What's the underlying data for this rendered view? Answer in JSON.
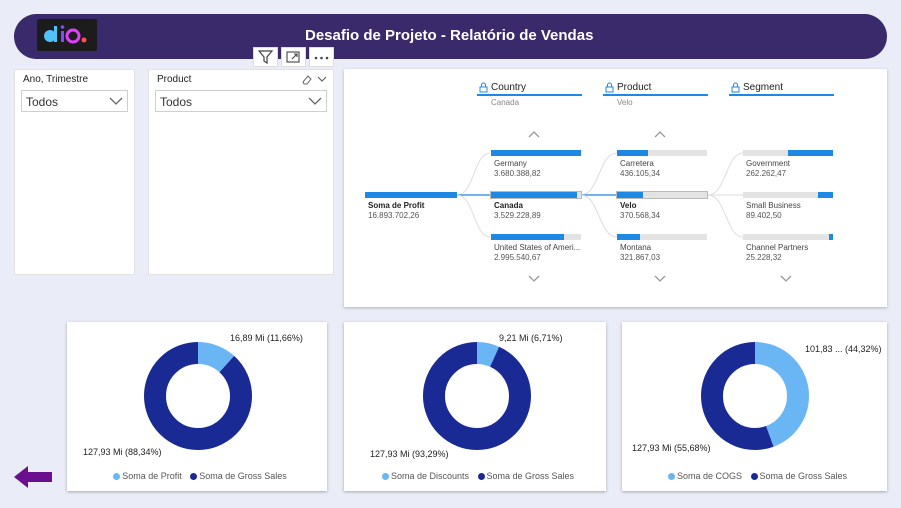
{
  "header": {
    "title": "Desafio de Projeto - Relatório de Vendas",
    "logo_icon": "dio-logo"
  },
  "slicers": [
    {
      "title": "Ano, Trimestre",
      "value": "Todos"
    },
    {
      "title": "Product",
      "value": "Todos"
    }
  ],
  "toolbar": {
    "icons": [
      "filter-icon",
      "focus-mode-icon",
      "more-options-icon"
    ]
  },
  "tree": {
    "levels": [
      {
        "name": "Country",
        "selected": "Canada"
      },
      {
        "name": "Product",
        "selected": "Velo"
      },
      {
        "name": "Segment",
        "selected": ""
      }
    ],
    "root": {
      "label": "Soma de Profit",
      "value": "16.893.702,26"
    },
    "country": [
      {
        "label": "Germany",
        "value": "3.680.388,82",
        "fill": 1.0
      },
      {
        "label": "Canada",
        "value": "3.529.228,89",
        "fill": 0.96
      },
      {
        "label": "United States of Ameri...",
        "value": "2.995.540,67",
        "fill": 0.81
      }
    ],
    "product": [
      {
        "label": "Carretera",
        "value": "436.105,34",
        "fill": 0.34
      },
      {
        "label": "Velo",
        "value": "370.568,34",
        "fill": 0.29
      },
      {
        "label": "Montana",
        "value": "321.867,03",
        "fill": 0.25
      }
    ],
    "segment": [
      {
        "label": "Government",
        "value": "262.262,47",
        "fill": 0.5
      },
      {
        "label": "Small Business",
        "value": "89.402,50",
        "fill": 0.17
      },
      {
        "label": "Channel Partners",
        "value": "25.228,32",
        "fill": 0.05
      }
    ]
  },
  "donuts": [
    {
      "small_label": "16,89 Mi (11,66%)",
      "big_label": "127,93 Mi (88,34%)",
      "small_fraction": 0.1166,
      "legend": [
        "Soma de Profit",
        "Soma de Gross Sales"
      ]
    },
    {
      "small_label": "9,21 Mi (6,71%)",
      "big_label": "127,93 Mi (93,29%)",
      "small_fraction": 0.0671,
      "legend": [
        "Soma de Discounts",
        "Soma de Gross Sales"
      ]
    },
    {
      "small_label": "101,83 ... (44,32%)",
      "big_label": "127,93 Mi (55,68%)",
      "small_fraction": 0.4432,
      "legend": [
        "Soma de COGS",
        "Soma de Gross Sales"
      ]
    }
  ],
  "colors": {
    "light": "#6ab6f5",
    "dark": "#1a2a94",
    "accent": "#1e88e5",
    "header": "#3a2a6b",
    "arrow": "#6a0f8e"
  },
  "nav": {
    "back_icon": "back-arrow-icon"
  }
}
